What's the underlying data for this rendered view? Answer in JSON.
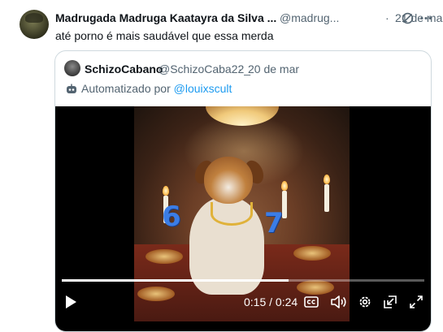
{
  "tweet": {
    "author_name": "Madrugada Madruga Kaatayra da Silva ...",
    "handle": "@madrug...",
    "separator": "·",
    "time": "21 de mar",
    "text": "até porno é mais saudável que essa merda",
    "icons": [
      "grok-icon",
      "more-options-icon"
    ]
  },
  "quote": {
    "author_name": "SchizoCabano",
    "handle": "@SchizoCaba22_",
    "separator": "·",
    "time": "20 de mar",
    "automated_label": "Automatizado por",
    "automated_by": "@louixscult",
    "icons": [
      "bot-icon"
    ]
  },
  "video": {
    "elapsed": "0:15",
    "duration": "0:24",
    "time_separator": " / ",
    "progress_fraction": 0.625,
    "scene_numbers": [
      "6",
      "7"
    ],
    "controls": [
      "play-icon",
      "closed-captions-icon",
      "volume-icon",
      "settings-icon",
      "picture-in-picture-icon",
      "fullscreen-icon"
    ]
  },
  "colors": {
    "link": "#1d9bf0",
    "secondary_text": "#536471",
    "border": "#cfd9de",
    "primary_text": "#0f1419"
  }
}
